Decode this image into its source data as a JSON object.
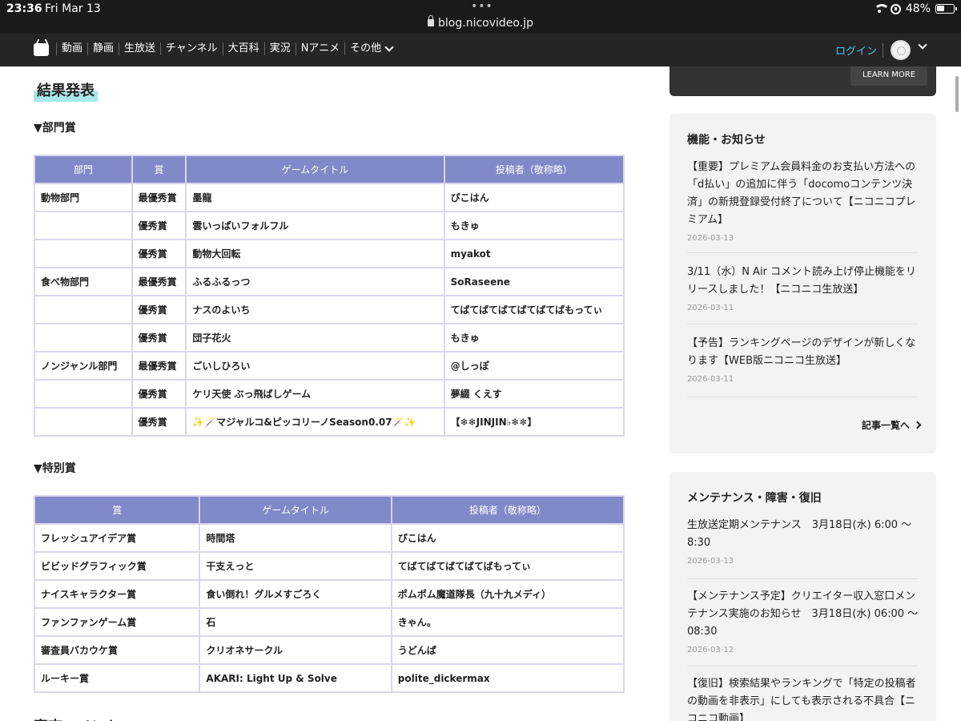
{
  "status": {
    "time": "23:36",
    "date": "Fri Mar 13",
    "dots": "•••",
    "battery": "48%",
    "battery_level": 0.48
  },
  "url": "blog.nicovideo.jp",
  "nav": {
    "items": [
      "動画",
      "静画",
      "生放送",
      "チャンネル",
      "大百科",
      "実況",
      "Nアニメ",
      "その他"
    ],
    "login": "ログイン"
  },
  "main": {
    "section_title": "結果発表",
    "category_heading": "▼部門賞",
    "special_heading": "▼特別賞",
    "next_heading_cut": "審査コメント"
  },
  "awards_table": {
    "headers": [
      "部門",
      "賞",
      "ゲームタイトル",
      "投稿者（敬称略）"
    ],
    "rows": [
      [
        "動物部門",
        "最優秀賞",
        "墨龍",
        "ぴこはん"
      ],
      [
        "",
        "優秀賞",
        "雲いっぱいフォルフル",
        "もきゅ"
      ],
      [
        "",
        "優秀賞",
        "動物大回転",
        "myakot"
      ],
      [
        "食べ物部門",
        "最優秀賞",
        "ふるふるっつ",
        "SoRaseene"
      ],
      [
        "",
        "優秀賞",
        "ナスのよいち",
        "てばてばてばてばてばてばもってぃ"
      ],
      [
        "",
        "優秀賞",
        "団子花火",
        "もきゅ"
      ],
      [
        "ノンジャンル部門",
        "最優秀賞",
        "ごいしひろい",
        "@しっぽ"
      ],
      [
        "",
        "優秀賞",
        "ケリ天使 ぶっ飛ばしゲーム",
        "夢綴 くえす"
      ],
      [
        "",
        "優秀賞",
        "✨🪄マジャルコ&ピッコリーノSeason0.07🪄✨",
        "【❄❄JINJIN♭❄❄】"
      ]
    ]
  },
  "special_table": {
    "headers": [
      "賞",
      "ゲームタイトル",
      "投稿者（敬称略）"
    ],
    "rows": [
      [
        "フレッシュアイデア賞",
        "時間塔",
        "ぴこはん"
      ],
      [
        "ビビッドグラフィック賞",
        "干支えっと",
        "てばてばてばてばてばもってぃ"
      ],
      [
        "ナイスキャラクター賞",
        "食い倒れ！グルメすごろく",
        "ポムポム魔道隊長（九十九メディ）"
      ],
      [
        "ファンファンゲーム賞",
        "石",
        "きゃん。"
      ],
      [
        "審査員バカウケ賞",
        "クリオネサークル",
        "うどんぱ"
      ],
      [
        "ルーキー賞",
        "AKARI: Light Up & Solve",
        "polite_dickermax"
      ]
    ]
  },
  "sidebar": {
    "ad_button": "LEARN MORE",
    "features": {
      "title": "機能・お知らせ",
      "items": [
        {
          "text": "【重要】プレミアム会員料金のお支払い方法への「d払い」の追加に伴う「docomoコンテンツ決済」の新規登録受付終了について【ニコニコプレミアム】",
          "date": "2026-03-13"
        },
        {
          "text": "3/11（水）N Air コメント読み上げ停止機能をリリースしました！【ニコニコ生放送】",
          "date": "2026-03-11"
        },
        {
          "text": "【予告】ランキングページのデザインが新しくなります【WEB版ニコニコ生放送】",
          "date": "2026-03-11"
        }
      ],
      "all_link": "記事一覧へ"
    },
    "maintenance": {
      "title": "メンテナンス・障害・復旧",
      "items": [
        {
          "text": "生放送定期メンテナンス　3月18日(水) 6:00 〜 8:30",
          "date": "2026-03-13"
        },
        {
          "text": "【メンテナンス予定】クリエイター収入窓口メンテナンス実施のお知らせ　3月18日(水) 06:00 〜 08:30",
          "date": "2026-03-12"
        },
        {
          "text": "【復旧】検索結果やランキングで「特定の投稿者の動画を非表示」にしても表示される不具合【ニコニコ動画】",
          "date": ""
        }
      ]
    }
  }
}
